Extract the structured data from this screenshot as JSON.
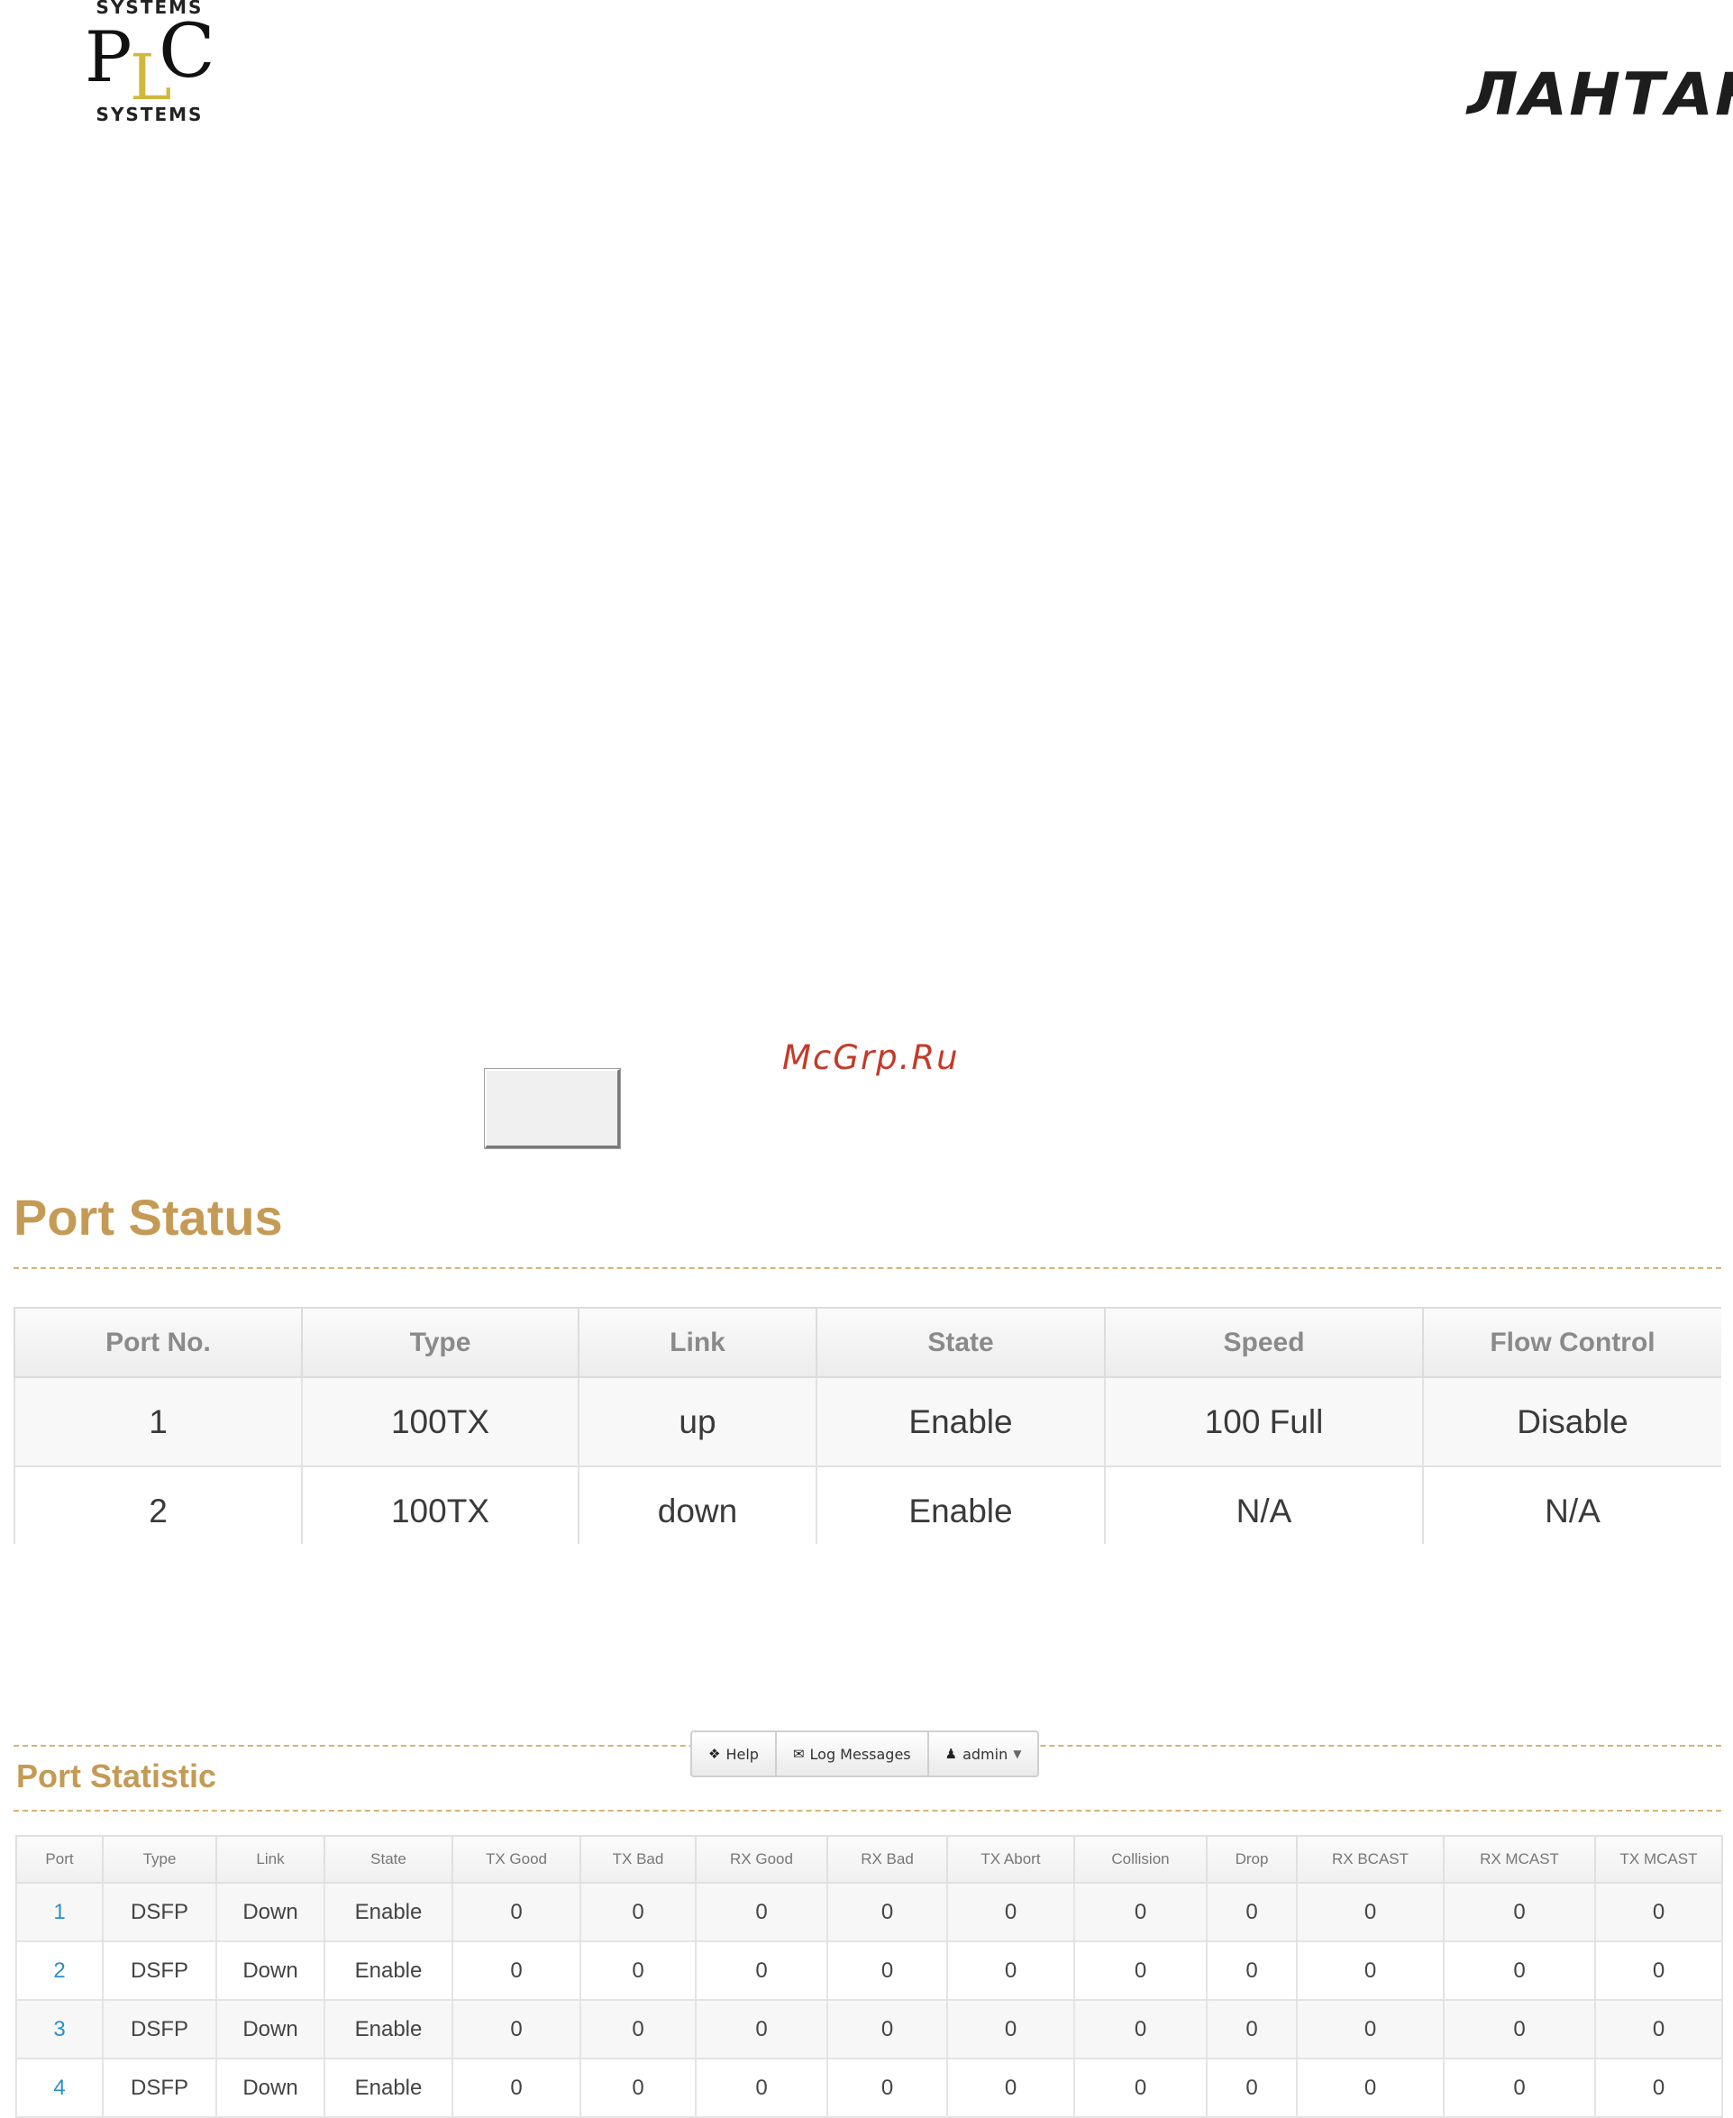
{
  "logos": {
    "plc": {
      "top_caption": "SYSTEMS",
      "letters": [
        "P",
        "L",
        "C"
      ],
      "bottom_caption": "SYSTEMS"
    },
    "lantan": {
      "text": "ЛАНТАН"
    }
  },
  "watermark": "McGrp.Ru",
  "port_status": {
    "title": "Port Status",
    "columns": [
      "Port No.",
      "Type",
      "Link",
      "State",
      "Speed",
      "Flow Control"
    ],
    "rows": [
      [
        "1",
        "100TX",
        "up",
        "Enable",
        "100 Full",
        "Disable"
      ],
      [
        "2",
        "100TX",
        "down",
        "Enable",
        "N/A",
        "N/A"
      ]
    ]
  },
  "toolbar": {
    "help": {
      "icon": "info-circle-icon",
      "label": "Help"
    },
    "log": {
      "icon": "envelope-icon",
      "label": "Log Messages"
    },
    "user": {
      "icon": "user-icon",
      "label": "admin"
    }
  },
  "port_statistic": {
    "title": "Port Statistic",
    "columns": [
      "Port",
      "Type",
      "Link",
      "State",
      "TX Good",
      "TX Bad",
      "RX Good",
      "RX Bad",
      "TX Abort",
      "Collision",
      "Drop",
      "RX BCAST",
      "RX MCAST",
      "TX MCAST"
    ],
    "rows": [
      [
        "1",
        "DSFP",
        "Down",
        "Enable",
        "0",
        "0",
        "0",
        "0",
        "0",
        "0",
        "0",
        "0",
        "0",
        "0"
      ],
      [
        "2",
        "DSFP",
        "Down",
        "Enable",
        "0",
        "0",
        "0",
        "0",
        "0",
        "0",
        "0",
        "0",
        "0",
        "0"
      ],
      [
        "3",
        "DSFP",
        "Down",
        "Enable",
        "0",
        "0",
        "0",
        "0",
        "0",
        "0",
        "0",
        "0",
        "0",
        "0"
      ],
      [
        "4",
        "DSFP",
        "Down",
        "Enable",
        "0",
        "0",
        "0",
        "0",
        "0",
        "0",
        "0",
        "0",
        "0",
        "0"
      ]
    ]
  },
  "colors": {
    "section_title": "#c49a55",
    "dashed_rule": "#d8b27a",
    "port_link": "#2b8fc9",
    "watermark": "#c43a2a",
    "logo_l": "#d2b73c"
  }
}
